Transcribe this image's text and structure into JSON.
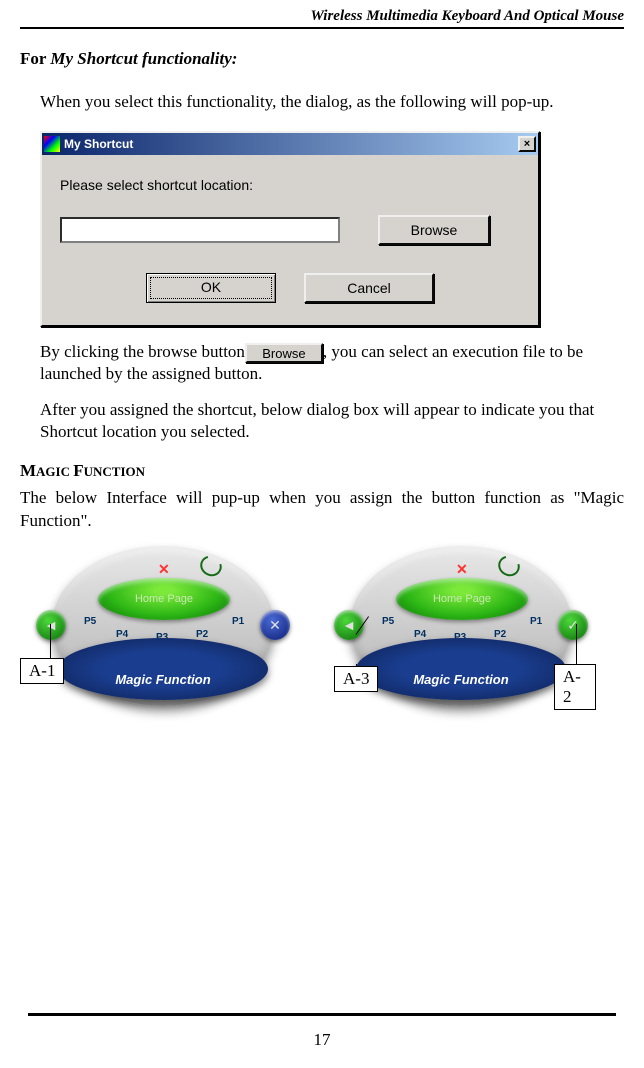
{
  "header": {
    "title": "Wireless Multimedia Keyboard And Optical Mouse"
  },
  "section1": {
    "for_label": "For ",
    "for_title": "My Shortcut functionality:",
    "intro": "When you select this functionality, the dialog, as the following will pop-up."
  },
  "dialog": {
    "title": "My Shortcut",
    "close": "×",
    "label": "Please select shortcut location:",
    "input_value": "",
    "browse": "Browse",
    "ok": "OK",
    "cancel": "Cancel"
  },
  "para_browse": {
    "before": "By clicking the browse button",
    "button": "Browse",
    "after": ", you can select an execution file to be launched by the assigned button."
  },
  "para_after": "After you assigned the shortcut, below dialog box will appear to indicate you that Shortcut location you selected.",
  "magic": {
    "heading_m": "M",
    "heading_agic": "AGIC ",
    "heading_f": "F",
    "heading_unction": "UNCTION",
    "para": "The below Interface will pup-up when you assign the button function as \"Magic Function\"."
  },
  "widget": {
    "home_page": "Home Page",
    "magic_function": "Magic Function",
    "p1": "P1",
    "p2": "P2",
    "p3": "P3",
    "p4": "P4",
    "p5": "P5",
    "left_arrow": "◄",
    "right_x": "✕",
    "right_check": "✓"
  },
  "callouts": {
    "a1": "A-1",
    "a2": "A-2",
    "a3": "A-3"
  },
  "footer": {
    "page": "17"
  }
}
